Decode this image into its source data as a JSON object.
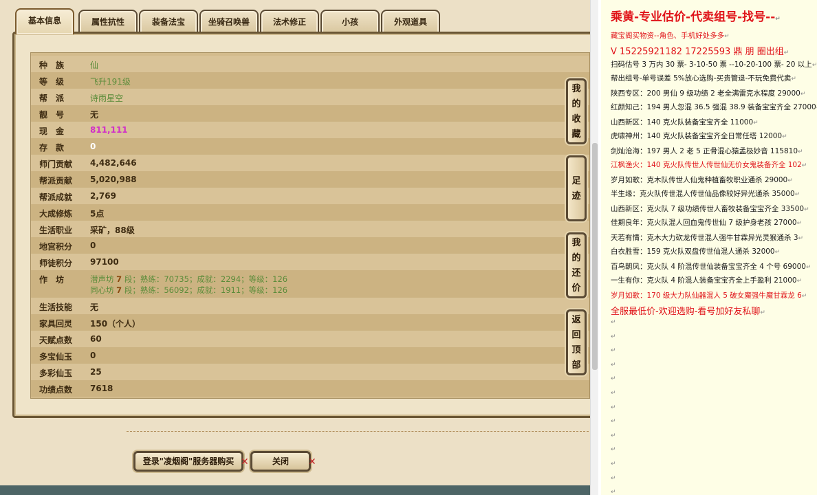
{
  "tabs": [
    "基本信息",
    "属性抗性",
    "装备法宝",
    "坐骑召唤兽",
    "法术修正",
    "小孩",
    "外观道具"
  ],
  "rows": [
    {
      "label": "种　族",
      "value": "仙"
    },
    {
      "label": "等　级",
      "value": "飞升191级"
    },
    {
      "label": "帮　派",
      "value": "诗雨星空"
    },
    {
      "label": "靓　号",
      "value": "无"
    },
    {
      "label": "现　金",
      "value": "811,111"
    },
    {
      "label": "存　款",
      "value": "0"
    },
    {
      "label": "师门贡献",
      "value": "4,482,646"
    },
    {
      "label": "帮派贡献",
      "value": "5,020,988"
    },
    {
      "label": "帮派成就",
      "value": "2,769"
    },
    {
      "label": "大成修炼",
      "value": "5点"
    },
    {
      "label": "生活职业",
      "value": "采矿，88级"
    },
    {
      "label": "地宫积分",
      "value": "0"
    },
    {
      "label": "师徒积分",
      "value": "97100"
    }
  ],
  "workshop": {
    "label": "作　坊",
    "line1": {
      "name": "潜声坊",
      "level": "7",
      "rest": "段；熟练：70735；成就：2294；等级：126"
    },
    "line2": {
      "name": "同心坊",
      "level": "7",
      "rest": "段；熟练：56092；成就：1911；等级：126"
    }
  },
  "rows2": [
    {
      "label": "生活技能",
      "value": "无"
    },
    {
      "label": "家具回灵",
      "value": "150（个人）"
    },
    {
      "label": "天赋点数",
      "value": "60"
    },
    {
      "label": "多宝仙玉",
      "value": "0"
    },
    {
      "label": "多彩仙玉",
      "value": "25"
    },
    {
      "label": "功绩点数",
      "value": "7618"
    }
  ],
  "side_buttons": [
    {
      "label": "我的收藏"
    },
    {
      "label": "足迹"
    },
    {
      "label": "我的还价"
    },
    {
      "label": "返回顶部"
    }
  ],
  "buttons": {
    "login": "登录\"凌烟阁\"服务器购买",
    "close": "关闭"
  },
  "ad": {
    "title": "乘黄-专业估价-代卖组号-找号--",
    "pm": "↵",
    "lines": [
      {
        "text": "藏宝阁买物资--角色、手机好处多多",
        "style": "red"
      },
      {
        "text": "V 15225921182    17225593 鼎  朋 圈出组",
        "style": "red big"
      },
      {
        "text": "扫码估号 3 万内 30 票- 3-10-50 票  --10-20-100 票- 20 以上",
        "style": ""
      },
      {
        "text": "帮出组号-单号误差 5%放心选购-买贵管退-不玩免费代卖",
        "style": ""
      },
      {
        "text": "陕西专区：200 男仙 9 级功绩 2 老全满雷克水程度 29000",
        "style": ""
      },
      {
        "text": "红颜知己：194 男人忽混 36.5 强混 38.9 装备宝宝齐全 27000",
        "style": ""
      },
      {
        "text": "山西新区：140 克火队装备宝宝齐全 11000",
        "style": ""
      },
      {
        "text": "虎啸神州：140 克火队装备宝宝齐全日常任塔 12000",
        "style": ""
      },
      {
        "text": "剑灿沧海：197 男人 2 老 5 正骨混心猿孟极妙音 115810",
        "style": ""
      },
      {
        "text": "江枫渔火：140 克火队传世人传世仙无价女鬼装备齐全 102",
        "style": "red"
      },
      {
        "text": "岁月如歌：克木队传世人仙鬼种植畜牧职业通杀 29000",
        "style": ""
      },
      {
        "text": "半生缘：克火队传世混人传世仙品像较好异光通杀 35000",
        "style": ""
      },
      {
        "text": "山西新区：克火队 7 级功绩传世人畜牧装备宝宝齐全 33500",
        "style": ""
      },
      {
        "text": "佳期良年：克火队混人回血鬼传世仙 7 级护身老孩 27000",
        "style": ""
      },
      {
        "text": "天若有情：克木大力砍龙传世混人强牛甘霖异光灵猴通杀 3",
        "style": ""
      },
      {
        "text": "白衣胜雪：159 克火队双盘传世仙混人通杀 32000",
        "style": ""
      },
      {
        "text": "百鸟朝凤：克火队 4 阶混传世仙装备宝宝齐全 4 个号 69000",
        "style": ""
      },
      {
        "text": "一生有你：克火队 4 阶混人装备宝宝齐全上手盈利 21000",
        "style": ""
      },
      {
        "text": "岁月如歌：170 级大力队仙器混人 5 破女魔强牛魔甘霖龙 6",
        "style": "red"
      },
      {
        "text": "全服最低价-欢迎选购-看号加好友私聊",
        "style": "red big"
      }
    ]
  }
}
